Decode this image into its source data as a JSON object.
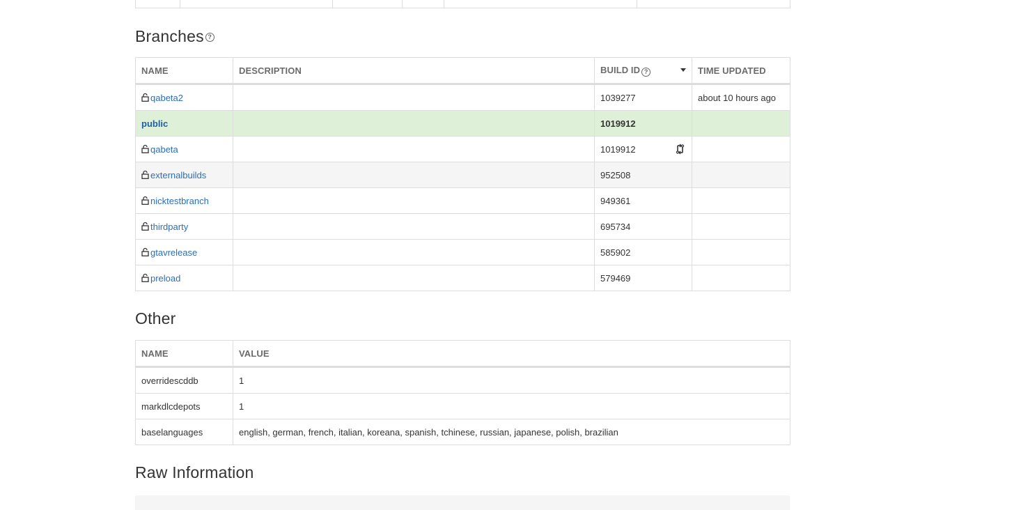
{
  "branches": {
    "title": "Branches",
    "help_glyph": "?",
    "columns": {
      "name": "NAME",
      "description": "DESCRIPTION",
      "build_id": "BUILD ID",
      "time_updated": "TIME UPDATED"
    },
    "rows": [
      {
        "name": "qabeta2",
        "description": "",
        "build_id": "1039277",
        "time_updated": "about 10 hours ago",
        "locked": true
      },
      {
        "name": "public",
        "description": "",
        "build_id": "1019912",
        "time_updated": "",
        "locked": false
      },
      {
        "name": "qabeta",
        "description": "",
        "build_id": "1019912",
        "time_updated": "",
        "locked": true
      },
      {
        "name": "externalbuilds",
        "description": "",
        "build_id": "952508",
        "time_updated": "",
        "locked": true
      },
      {
        "name": "nicktestbranch",
        "description": "",
        "build_id": "949361",
        "time_updated": "",
        "locked": true
      },
      {
        "name": "thirdparty",
        "description": "",
        "build_id": "695734",
        "time_updated": "",
        "locked": true
      },
      {
        "name": "gtavrelease",
        "description": "",
        "build_id": "585902",
        "time_updated": "",
        "locked": true
      },
      {
        "name": "preload",
        "description": "",
        "build_id": "579469",
        "time_updated": "",
        "locked": true
      }
    ]
  },
  "other": {
    "title": "Other",
    "columns": {
      "name": "NAME",
      "value": "VALUE"
    },
    "rows": [
      {
        "name": "overridescddb",
        "value": "1"
      },
      {
        "name": "markdlcdepots",
        "value": "1"
      },
      {
        "name": "baselanguages",
        "value": "english, german, french, italian, koreana, spanish, tchinese, russian, japanese, polish, brazilian"
      }
    ]
  },
  "raw": {
    "title": "Raw Information"
  },
  "colors": {
    "link": "#2a6ebb",
    "public_row_bg": "#dff0d8",
    "alt_row_bg": "#f5f5f5",
    "border": "#dddddd"
  },
  "icons": {
    "lock": "lock-icon",
    "help": "help-icon",
    "sort": "sort-caret-icon",
    "diff": "diff-icon"
  }
}
